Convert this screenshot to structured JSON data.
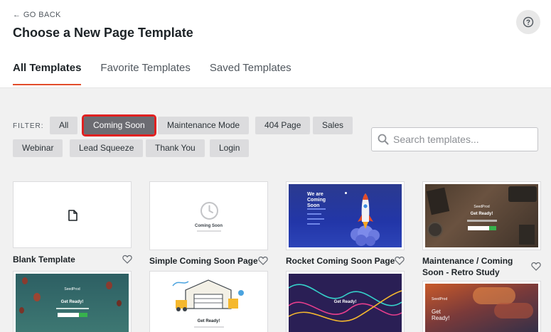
{
  "header": {
    "go_back": "← GO BACK",
    "title": "Choose a New Page Template",
    "help_icon": "question-circle-icon"
  },
  "tabs": [
    {
      "label": "All Templates",
      "active": true
    },
    {
      "label": "Favorite Templates",
      "active": false
    },
    {
      "label": "Saved Templates",
      "active": false
    }
  ],
  "filter": {
    "label": "FILTER:",
    "chips": [
      "All",
      "Coming Soon",
      "Maintenance Mode",
      "404 Page",
      "Sales",
      "Webinar",
      "Lead Squeeze",
      "Thank You",
      "Login"
    ],
    "selected": "Coming Soon"
  },
  "search": {
    "placeholder": "Search templates...",
    "icon": "search-icon"
  },
  "templates": [
    {
      "title": "Blank Template"
    },
    {
      "title": "Simple Coming Soon Page",
      "thumb_text": "Coming Soon"
    },
    {
      "title": "Rocket Coming Soon Page",
      "thumb_text": "We are Coming Soon"
    },
    {
      "title": "Maintenance / Coming Soon - Retro Study",
      "thumb_text": "Get Ready!",
      "brand": "SeedProd"
    },
    {
      "thumb_text": "Get Ready!",
      "brand": "SeedProd"
    },
    {
      "thumb_text": "Get Ready!"
    },
    {
      "thumb_text": "Get Ready!"
    },
    {
      "thumb_text": "Get Ready!",
      "brand": "SeedProd"
    }
  ],
  "colors": {
    "accent": "#e24d2b",
    "chip": "#dcdcde",
    "chip_active": "#6c6c72",
    "highlight": "#e02020"
  }
}
